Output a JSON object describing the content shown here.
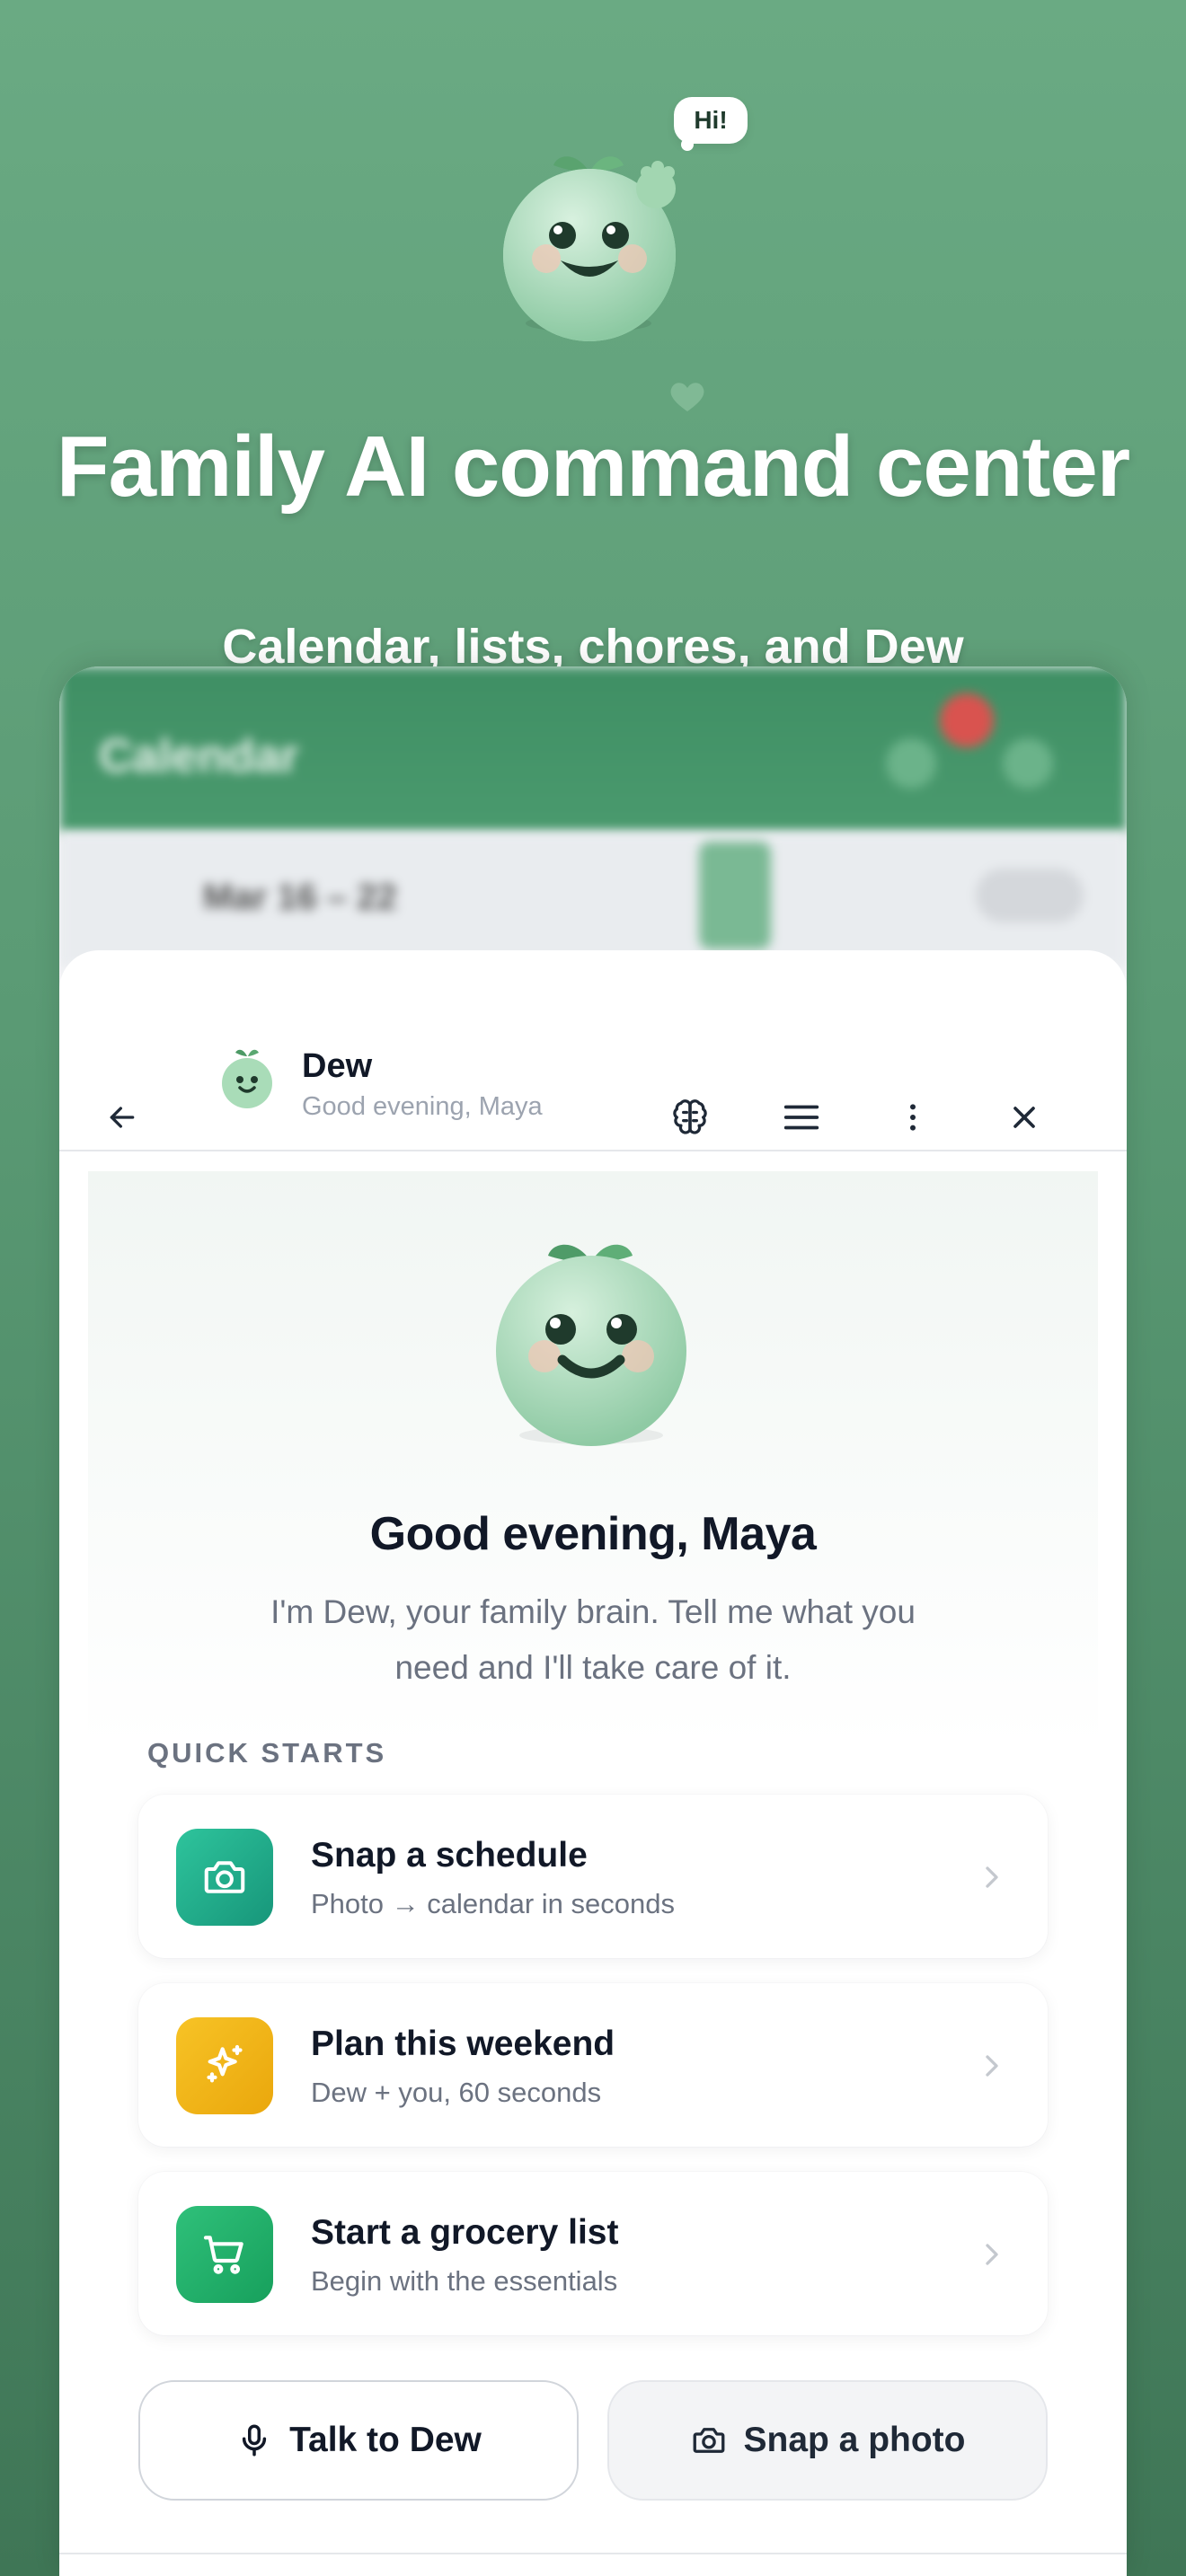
{
  "hero": {
    "bubble": "Hi!",
    "title": "Family AI command center",
    "subtitle": "Calendar, lists, chores, and Dew"
  },
  "background_app": {
    "title": "Calendar",
    "date_range": "Mar 16 – 22"
  },
  "assistant": {
    "name": "Dew",
    "status": "Good evening, Maya",
    "greeting": "Good evening, Maya",
    "intro": "I'm Dew, your family brain. Tell me what you need and I'll take care of it."
  },
  "header_icons": [
    "back-arrow-icon",
    "brain-icon",
    "menu-icon",
    "more-vertical-icon",
    "close-icon"
  ],
  "quick_starts": {
    "label": "QUICK STARTS",
    "items": [
      {
        "title": "Snap a schedule",
        "subtitle": "Photo → calendar in seconds",
        "icon": "camera-icon",
        "color": "#1fae8a"
      },
      {
        "title": "Plan this weekend",
        "subtitle": "Dew + you, 60 seconds",
        "icon": "sparkles-icon",
        "color": "#f0b416"
      },
      {
        "title": "Start a grocery list",
        "subtitle": "Begin with the essentials",
        "icon": "cart-icon",
        "color": "#22b26a"
      }
    ]
  },
  "actions": {
    "talk": "Talk to Dew",
    "snap": "Snap a photo"
  },
  "colors": {
    "brand_green": "#5a9a74",
    "mascot": "#a8d9b6",
    "text_primary": "#111827",
    "text_muted": "#6b7280"
  }
}
